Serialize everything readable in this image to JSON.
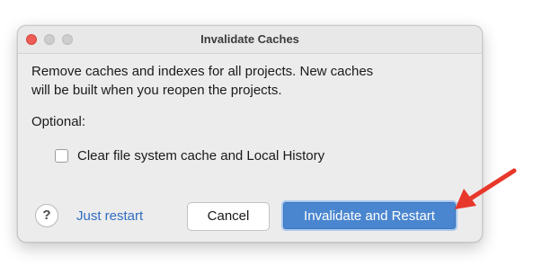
{
  "window": {
    "title": "Invalidate Caches"
  },
  "body": {
    "message_line1": "Remove caches and indexes for all projects. New caches",
    "message_line2": "will be built when you reopen the projects.",
    "optional_label": "Optional:",
    "checkbox": {
      "label": "Clear file system cache and Local History",
      "checked": false
    }
  },
  "footer": {
    "help_glyph": "?",
    "just_restart_label": "Just restart",
    "cancel_label": "Cancel",
    "invalidate_label": "Invalidate and Restart"
  },
  "colors": {
    "accent": "#4a86cf",
    "link": "#2f6cc2",
    "annotation_arrow": "#e8382b"
  },
  "icons": {
    "help": "help-icon",
    "annotation": "red-arrow-icon"
  }
}
